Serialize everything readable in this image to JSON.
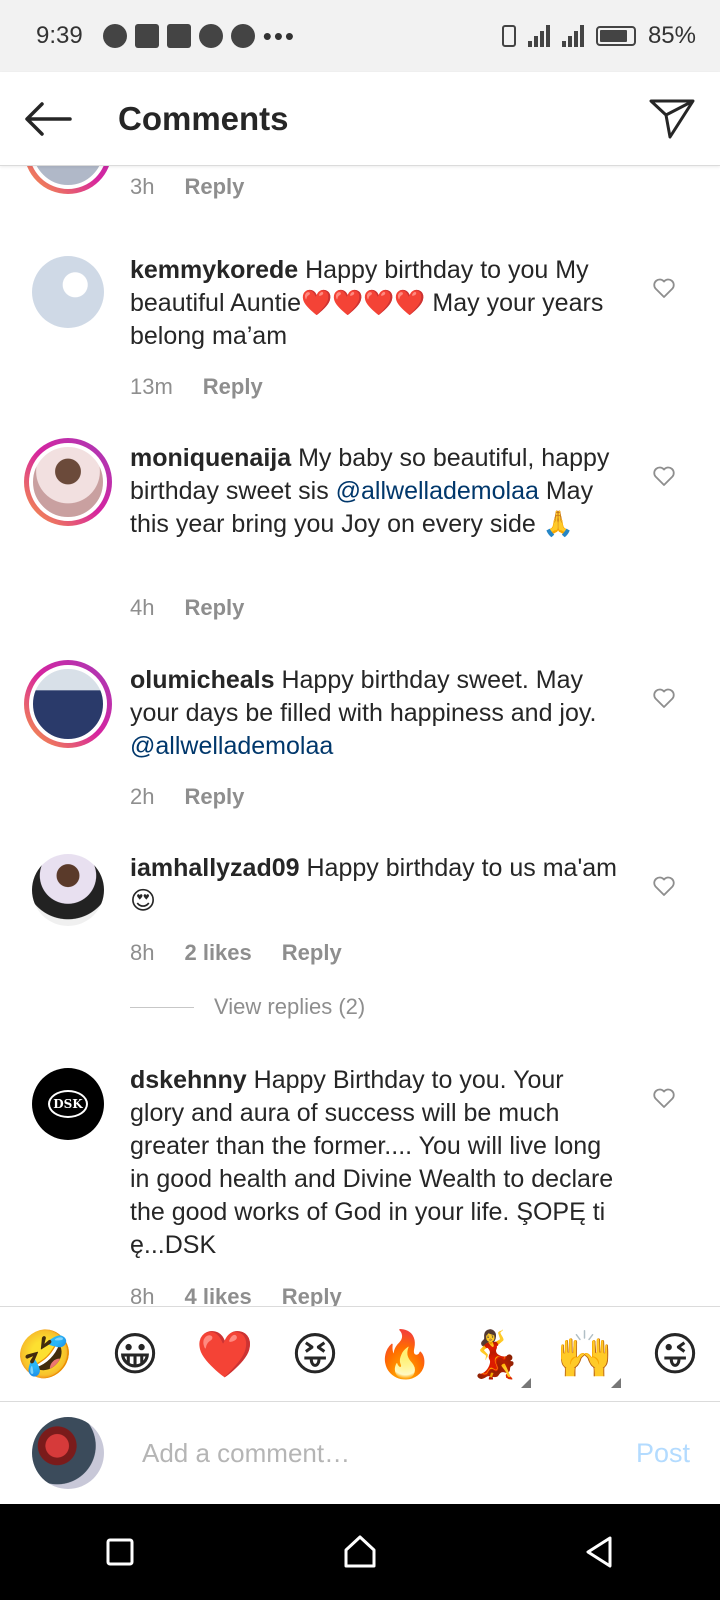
{
  "status_bar": {
    "time": "9:39",
    "battery": "85%",
    "battery_level": 0.85,
    "left_icons": [
      "music-icon",
      "facebook-icon",
      "news-icon",
      "messenger-icon",
      "circle-icon",
      "more-dots-icon"
    ],
    "right_icons": [
      "vibrate-icon",
      "signal-icon",
      "signal-icon",
      "battery-icon"
    ]
  },
  "header": {
    "title": "Comments"
  },
  "comments": [
    {
      "time": "3h",
      "reply": "Reply"
    },
    {
      "username": "kemmykorede",
      "text": "Happy birthday to you My beautiful Auntie❤️❤️❤️❤️ May your years belong ma’am",
      "time": "13m",
      "reply": "Reply"
    },
    {
      "username": "moniquenaija",
      "text_before": "My baby so beautiful,  happy birthday sweet sis ",
      "mention": "@allwellademolaa",
      "text_after": " May this year bring you Joy on every side 🙏",
      "time": "4h",
      "reply": "Reply"
    },
    {
      "username": "olumicheals",
      "text_before": "Happy birthday sweet. May your days be filled with happiness and joy. ",
      "mention": "@allwellademolaa",
      "time": "2h",
      "reply": "Reply"
    },
    {
      "username": "iamhallyzad09",
      "text": "Happy birthday to us ma'am 😍",
      "time": "8h",
      "likes": "2 likes",
      "reply": "Reply",
      "view_replies": "View replies (2)"
    },
    {
      "username": "dskehnny",
      "text": "Happy Birthday to you. Your glory and aura of success will be much greater than the former.... You will live long in good health and Divine Wealth to declare the good works of God in your life. ŞOPĘ ti ę...DSK",
      "avatar_text": "DSK",
      "time": "8h",
      "likes": "4 likes",
      "reply": "Reply"
    }
  ],
  "reactions": [
    "🤣",
    "😀",
    "❤️",
    "😝",
    "🔥",
    "💃",
    "🙌",
    "😜"
  ],
  "input": {
    "placeholder": "Add a comment…",
    "post": "Post"
  },
  "colors": {
    "mention": "#00376b",
    "meta": "#8e8e8e",
    "post_disabled": "#b3dbff"
  }
}
